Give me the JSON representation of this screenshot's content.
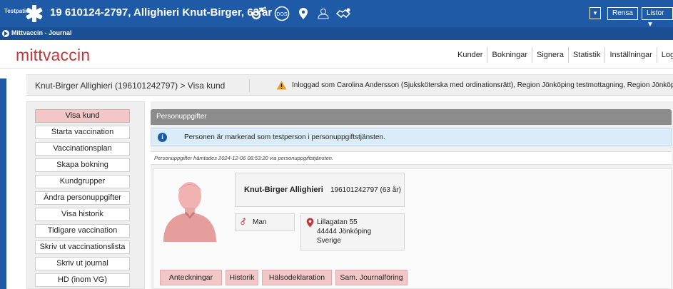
{
  "banner": {
    "testpatient_label": "Testpatient",
    "patient_text": "19 610124-2797,  Allighieri Knut-Birger, 63 år",
    "dos_label": "DOS",
    "rensa_label": "Rensa",
    "listor_label": "Listor ▼",
    "dropdown_glyph": "▾",
    "colors": {
      "background": "#1f5aa6",
      "accent": "#c0383b"
    }
  },
  "appbar": {
    "title": "Mittvaccin - Journal"
  },
  "header": {
    "logo": "mittvaccin",
    "nav": [
      "Kunder",
      "Bokningar",
      "Signera",
      "Statistik",
      "Inställningar",
      "Logg"
    ]
  },
  "breadcrumb": {
    "path": "Knut-Birger Allighieri (196101242797) > Visa kund",
    "login_message": "Inloggad som Carolina Andersson (Sjuksköterska med ordinationsrätt), Region Jönköping testmottagning, Region Jönköpings län"
  },
  "sidebar": {
    "items": [
      {
        "label": "Visa kund",
        "active": true
      },
      {
        "label": "Starta vaccination"
      },
      {
        "label": "Vaccinationsplan"
      },
      {
        "label": "Skapa bokning"
      },
      {
        "label": "Kundgrupper"
      },
      {
        "label": "Ändra personuppgifter"
      },
      {
        "label": "Visa historik"
      },
      {
        "label": "Tidigare vaccination"
      },
      {
        "label": "Skriv ut vaccinationslista"
      },
      {
        "label": "Skriv ut journal"
      },
      {
        "label": "HD (inom VG)"
      }
    ]
  },
  "panel": {
    "title": "Personuppgifter",
    "info_icon": "i",
    "info_text": "Personen är markerad som testperson i personuppgiftstjänsten.",
    "fetched_text": "Personuppgifter hämtades 2024-12-06 08:53:20 via personuppgiftstjänsten."
  },
  "person": {
    "name": "Knut-Birger Allighieri",
    "pnr": "196101242797 (63 år)",
    "gender_icon": "⚦",
    "sex": "Man",
    "address": [
      "Lillagatan 55",
      "44444 Jönköping",
      "Sverige"
    ]
  },
  "tabs": [
    "Anteckningar",
    "Historik",
    "Hälsodeklaration",
    "Sam. Journalföring"
  ]
}
